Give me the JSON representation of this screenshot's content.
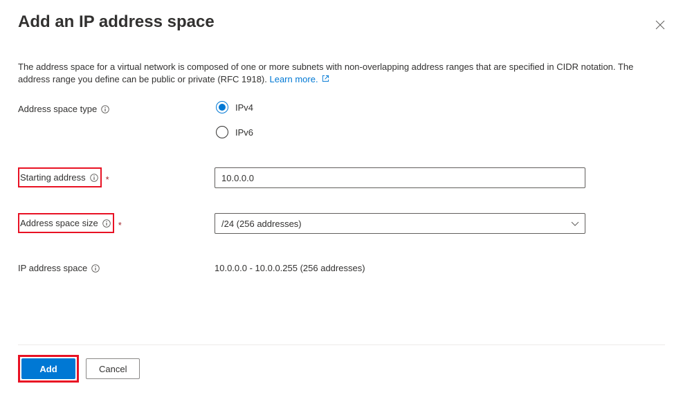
{
  "title": "Add an IP address space",
  "description": {
    "text": "The address space for a virtual network is composed of one or more subnets with non-overlapping address ranges that are specified in CIDR notation. The address range you define can be public or private (RFC 1918). ",
    "learn_more_label": "Learn more."
  },
  "labels": {
    "address_space_type": "Address space type",
    "starting_address": "Starting address",
    "address_space_size": "Address space size",
    "ip_address_space": "IP address space"
  },
  "radio": {
    "ipv4": "IPv4",
    "ipv6": "IPv6",
    "selected": "ipv4"
  },
  "fields": {
    "starting_address_value": "10.0.0.0",
    "address_space_size_value": "/24 (256 addresses)",
    "ip_address_space_value": "10.0.0.0 - 10.0.0.255 (256 addresses)"
  },
  "buttons": {
    "add": "Add",
    "cancel": "Cancel"
  }
}
